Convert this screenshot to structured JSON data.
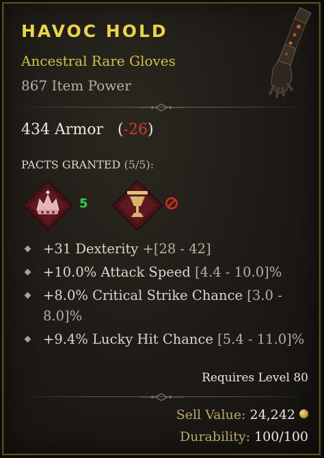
{
  "item": {
    "name": "HAVOC HOLD",
    "type": "Ancestral Rare Gloves",
    "power": "867 Item Power"
  },
  "armor": {
    "text": "434 Armor",
    "delta_open": "(",
    "delta": "-26",
    "delta_close": ")"
  },
  "pacts": {
    "label": "PACTS GRANTED",
    "count": "(5/5):",
    "items": [
      {
        "icon": "crown-sigil-icon",
        "value": "5"
      },
      {
        "icon": "chalice-sigil-icon",
        "value": "blocked-icon"
      }
    ]
  },
  "affixes": [
    {
      "text": "+31 Dexterity",
      "range": "+[28 - 42]"
    },
    {
      "text": "+10.0% Attack Speed",
      "range": "[4.4 - 10.0]%"
    },
    {
      "text": "+8.0% Critical Strike Chance",
      "range": "[3.0 - 8.0]%"
    },
    {
      "text": "+9.4% Lucky Hit Chance",
      "range": "[5.4 - 11.0]%"
    }
  ],
  "requirement": "Requires Level 80",
  "sell": {
    "label": "Sell Value:",
    "value": "24,242"
  },
  "durability": {
    "label": "Durability:",
    "value": "100/100"
  },
  "colors": {
    "title": "#e9d44a",
    "rarity": "#cfc44b",
    "negative": "#d23b2c",
    "pact_value": "#2fd04b",
    "border": "#5e4d1c"
  }
}
